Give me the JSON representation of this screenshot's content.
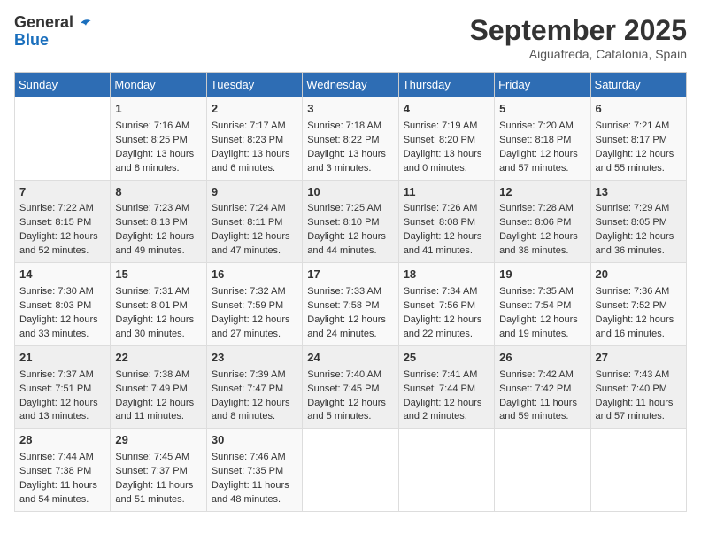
{
  "header": {
    "logo_line1": "General",
    "logo_line2": "Blue",
    "month": "September 2025",
    "location": "Aiguafreda, Catalonia, Spain"
  },
  "weekdays": [
    "Sunday",
    "Monday",
    "Tuesday",
    "Wednesday",
    "Thursday",
    "Friday",
    "Saturday"
  ],
  "weeks": [
    [
      {
        "day": "",
        "sunrise": "",
        "sunset": "",
        "daylight": ""
      },
      {
        "day": "1",
        "sunrise": "Sunrise: 7:16 AM",
        "sunset": "Sunset: 8:25 PM",
        "daylight": "Daylight: 13 hours and 8 minutes."
      },
      {
        "day": "2",
        "sunrise": "Sunrise: 7:17 AM",
        "sunset": "Sunset: 8:23 PM",
        "daylight": "Daylight: 13 hours and 6 minutes."
      },
      {
        "day": "3",
        "sunrise": "Sunrise: 7:18 AM",
        "sunset": "Sunset: 8:22 PM",
        "daylight": "Daylight: 13 hours and 3 minutes."
      },
      {
        "day": "4",
        "sunrise": "Sunrise: 7:19 AM",
        "sunset": "Sunset: 8:20 PM",
        "daylight": "Daylight: 13 hours and 0 minutes."
      },
      {
        "day": "5",
        "sunrise": "Sunrise: 7:20 AM",
        "sunset": "Sunset: 8:18 PM",
        "daylight": "Daylight: 12 hours and 57 minutes."
      },
      {
        "day": "6",
        "sunrise": "Sunrise: 7:21 AM",
        "sunset": "Sunset: 8:17 PM",
        "daylight": "Daylight: 12 hours and 55 minutes."
      }
    ],
    [
      {
        "day": "7",
        "sunrise": "Sunrise: 7:22 AM",
        "sunset": "Sunset: 8:15 PM",
        "daylight": "Daylight: 12 hours and 52 minutes."
      },
      {
        "day": "8",
        "sunrise": "Sunrise: 7:23 AM",
        "sunset": "Sunset: 8:13 PM",
        "daylight": "Daylight: 12 hours and 49 minutes."
      },
      {
        "day": "9",
        "sunrise": "Sunrise: 7:24 AM",
        "sunset": "Sunset: 8:11 PM",
        "daylight": "Daylight: 12 hours and 47 minutes."
      },
      {
        "day": "10",
        "sunrise": "Sunrise: 7:25 AM",
        "sunset": "Sunset: 8:10 PM",
        "daylight": "Daylight: 12 hours and 44 minutes."
      },
      {
        "day": "11",
        "sunrise": "Sunrise: 7:26 AM",
        "sunset": "Sunset: 8:08 PM",
        "daylight": "Daylight: 12 hours and 41 minutes."
      },
      {
        "day": "12",
        "sunrise": "Sunrise: 7:28 AM",
        "sunset": "Sunset: 8:06 PM",
        "daylight": "Daylight: 12 hours and 38 minutes."
      },
      {
        "day": "13",
        "sunrise": "Sunrise: 7:29 AM",
        "sunset": "Sunset: 8:05 PM",
        "daylight": "Daylight: 12 hours and 36 minutes."
      }
    ],
    [
      {
        "day": "14",
        "sunrise": "Sunrise: 7:30 AM",
        "sunset": "Sunset: 8:03 PM",
        "daylight": "Daylight: 12 hours and 33 minutes."
      },
      {
        "day": "15",
        "sunrise": "Sunrise: 7:31 AM",
        "sunset": "Sunset: 8:01 PM",
        "daylight": "Daylight: 12 hours and 30 minutes."
      },
      {
        "day": "16",
        "sunrise": "Sunrise: 7:32 AM",
        "sunset": "Sunset: 7:59 PM",
        "daylight": "Daylight: 12 hours and 27 minutes."
      },
      {
        "day": "17",
        "sunrise": "Sunrise: 7:33 AM",
        "sunset": "Sunset: 7:58 PM",
        "daylight": "Daylight: 12 hours and 24 minutes."
      },
      {
        "day": "18",
        "sunrise": "Sunrise: 7:34 AM",
        "sunset": "Sunset: 7:56 PM",
        "daylight": "Daylight: 12 hours and 22 minutes."
      },
      {
        "day": "19",
        "sunrise": "Sunrise: 7:35 AM",
        "sunset": "Sunset: 7:54 PM",
        "daylight": "Daylight: 12 hours and 19 minutes."
      },
      {
        "day": "20",
        "sunrise": "Sunrise: 7:36 AM",
        "sunset": "Sunset: 7:52 PM",
        "daylight": "Daylight: 12 hours and 16 minutes."
      }
    ],
    [
      {
        "day": "21",
        "sunrise": "Sunrise: 7:37 AM",
        "sunset": "Sunset: 7:51 PM",
        "daylight": "Daylight: 12 hours and 13 minutes."
      },
      {
        "day": "22",
        "sunrise": "Sunrise: 7:38 AM",
        "sunset": "Sunset: 7:49 PM",
        "daylight": "Daylight: 12 hours and 11 minutes."
      },
      {
        "day": "23",
        "sunrise": "Sunrise: 7:39 AM",
        "sunset": "Sunset: 7:47 PM",
        "daylight": "Daylight: 12 hours and 8 minutes."
      },
      {
        "day": "24",
        "sunrise": "Sunrise: 7:40 AM",
        "sunset": "Sunset: 7:45 PM",
        "daylight": "Daylight: 12 hours and 5 minutes."
      },
      {
        "day": "25",
        "sunrise": "Sunrise: 7:41 AM",
        "sunset": "Sunset: 7:44 PM",
        "daylight": "Daylight: 12 hours and 2 minutes."
      },
      {
        "day": "26",
        "sunrise": "Sunrise: 7:42 AM",
        "sunset": "Sunset: 7:42 PM",
        "daylight": "Daylight: 11 hours and 59 minutes."
      },
      {
        "day": "27",
        "sunrise": "Sunrise: 7:43 AM",
        "sunset": "Sunset: 7:40 PM",
        "daylight": "Daylight: 11 hours and 57 minutes."
      }
    ],
    [
      {
        "day": "28",
        "sunrise": "Sunrise: 7:44 AM",
        "sunset": "Sunset: 7:38 PM",
        "daylight": "Daylight: 11 hours and 54 minutes."
      },
      {
        "day": "29",
        "sunrise": "Sunrise: 7:45 AM",
        "sunset": "Sunset: 7:37 PM",
        "daylight": "Daylight: 11 hours and 51 minutes."
      },
      {
        "day": "30",
        "sunrise": "Sunrise: 7:46 AM",
        "sunset": "Sunset: 7:35 PM",
        "daylight": "Daylight: 11 hours and 48 minutes."
      },
      {
        "day": "",
        "sunrise": "",
        "sunset": "",
        "daylight": ""
      },
      {
        "day": "",
        "sunrise": "",
        "sunset": "",
        "daylight": ""
      },
      {
        "day": "",
        "sunrise": "",
        "sunset": "",
        "daylight": ""
      },
      {
        "day": "",
        "sunrise": "",
        "sunset": "",
        "daylight": ""
      }
    ]
  ]
}
